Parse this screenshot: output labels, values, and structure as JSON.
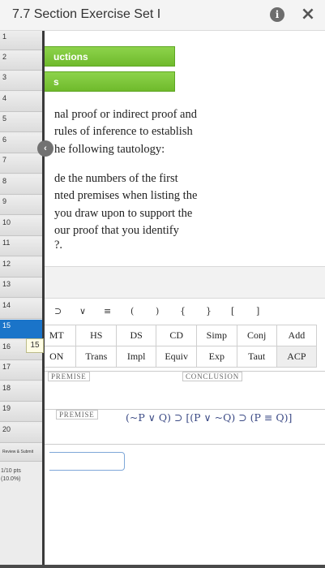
{
  "header": {
    "title": "7.7 Section Exercise Set I",
    "info_icon": "i",
    "close_icon": "×"
  },
  "sidebar": {
    "items": [
      "1",
      "2",
      "3",
      "4",
      "5",
      "6",
      "7",
      "8",
      "9",
      "10",
      "11",
      "12",
      "13",
      "14",
      "15",
      "16",
      "17",
      "18",
      "19",
      "20"
    ],
    "active_item": "15",
    "review_label": "Review & Submit",
    "points": "1/10 pts",
    "percent": "(10.0%)"
  },
  "content": {
    "buttons": [
      "uctions",
      "s"
    ],
    "paragraph1": [
      "nal proof or indirect proof and",
      "rules of inference to establish",
      "he following tautology:"
    ],
    "paragraph2": [
      "de the numbers of the first",
      "nted premises when listing the",
      " you draw upon to support the",
      "our proof that you identify",
      "?."
    ],
    "collapse_icon": "‹",
    "symbols": [
      "⊃",
      "∨",
      "≡",
      "(",
      ")",
      "{",
      "}",
      "[",
      "]"
    ],
    "rules_row1": [
      "MT",
      "HS",
      "DS",
      "CD",
      "Simp",
      "Conj",
      "Add"
    ],
    "rules_row2": [
      "ON",
      "Trans",
      "Impl",
      "Equiv",
      "Exp",
      "Taut",
      "ACP"
    ],
    "line_tag": "15",
    "premise_label": "PREMISE",
    "conclusion_label": "CONCLUSION",
    "conclusion": "(~P ∨ Q) ⊃ [(P ∨ ~Q) ⊃ (P ≡ Q)]",
    "premise_label_2": "PREMISE",
    "premise_input_value": ""
  },
  "colors": {
    "active_blue": "#1a74c9",
    "button_green": "#7ac53a",
    "conclusion_text": "#3b4a85"
  }
}
